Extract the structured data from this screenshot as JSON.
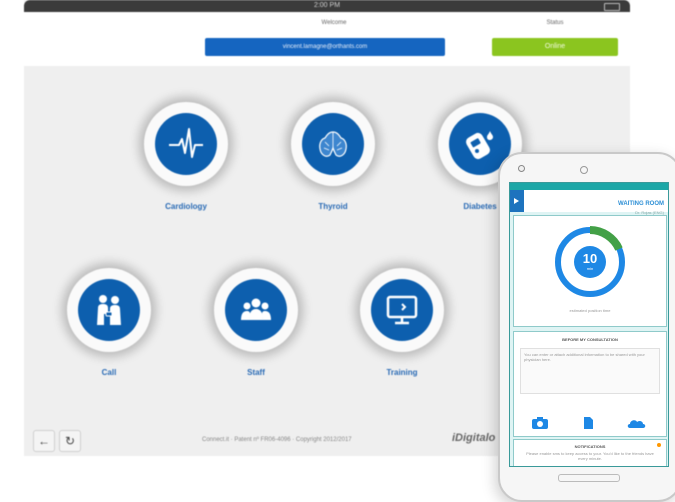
{
  "tablet": {
    "status_time": "2:00 PM",
    "header": {
      "welcome_label": "Welcome",
      "email": "vincent.lamagne@orthants.com",
      "status_label": "Status",
      "status_value": "Online"
    },
    "tiles": [
      {
        "label": "Cardiology",
        "icon": "heart-rate-icon"
      },
      {
        "label": "Thyroid",
        "icon": "thyroid-icon"
      },
      {
        "label": "Diabetes",
        "icon": "glucose-meter-icon"
      },
      {
        "label": "Call",
        "icon": "call-people-icon"
      },
      {
        "label": "Staff",
        "icon": "staff-group-icon"
      },
      {
        "label": "Training",
        "icon": "presentation-screen-icon"
      }
    ],
    "footer": {
      "text": "Connect.it · Patent nº FR06-4096 · Copyright 2012/2017",
      "logo": "iDigitalo"
    }
  },
  "phone": {
    "title": "WAITING ROOM",
    "subtitle": "Dr. Rojas (ENG)",
    "timer_value": "10",
    "timer_unit": "min",
    "timer_caption": "estimated position time",
    "before_title": "BEFORE MY CONSULTATION",
    "before_text": "You can enter or attach additional information to be shared with your physician here.",
    "notif_title": "NOTIFICATIONS",
    "notif_text": "Please enable sms to keep access to your. You'd like to the friends have every minute.",
    "colors": {
      "accent": "#1e88e5",
      "teal": "#1ca7a7",
      "green": "#43a047"
    }
  }
}
